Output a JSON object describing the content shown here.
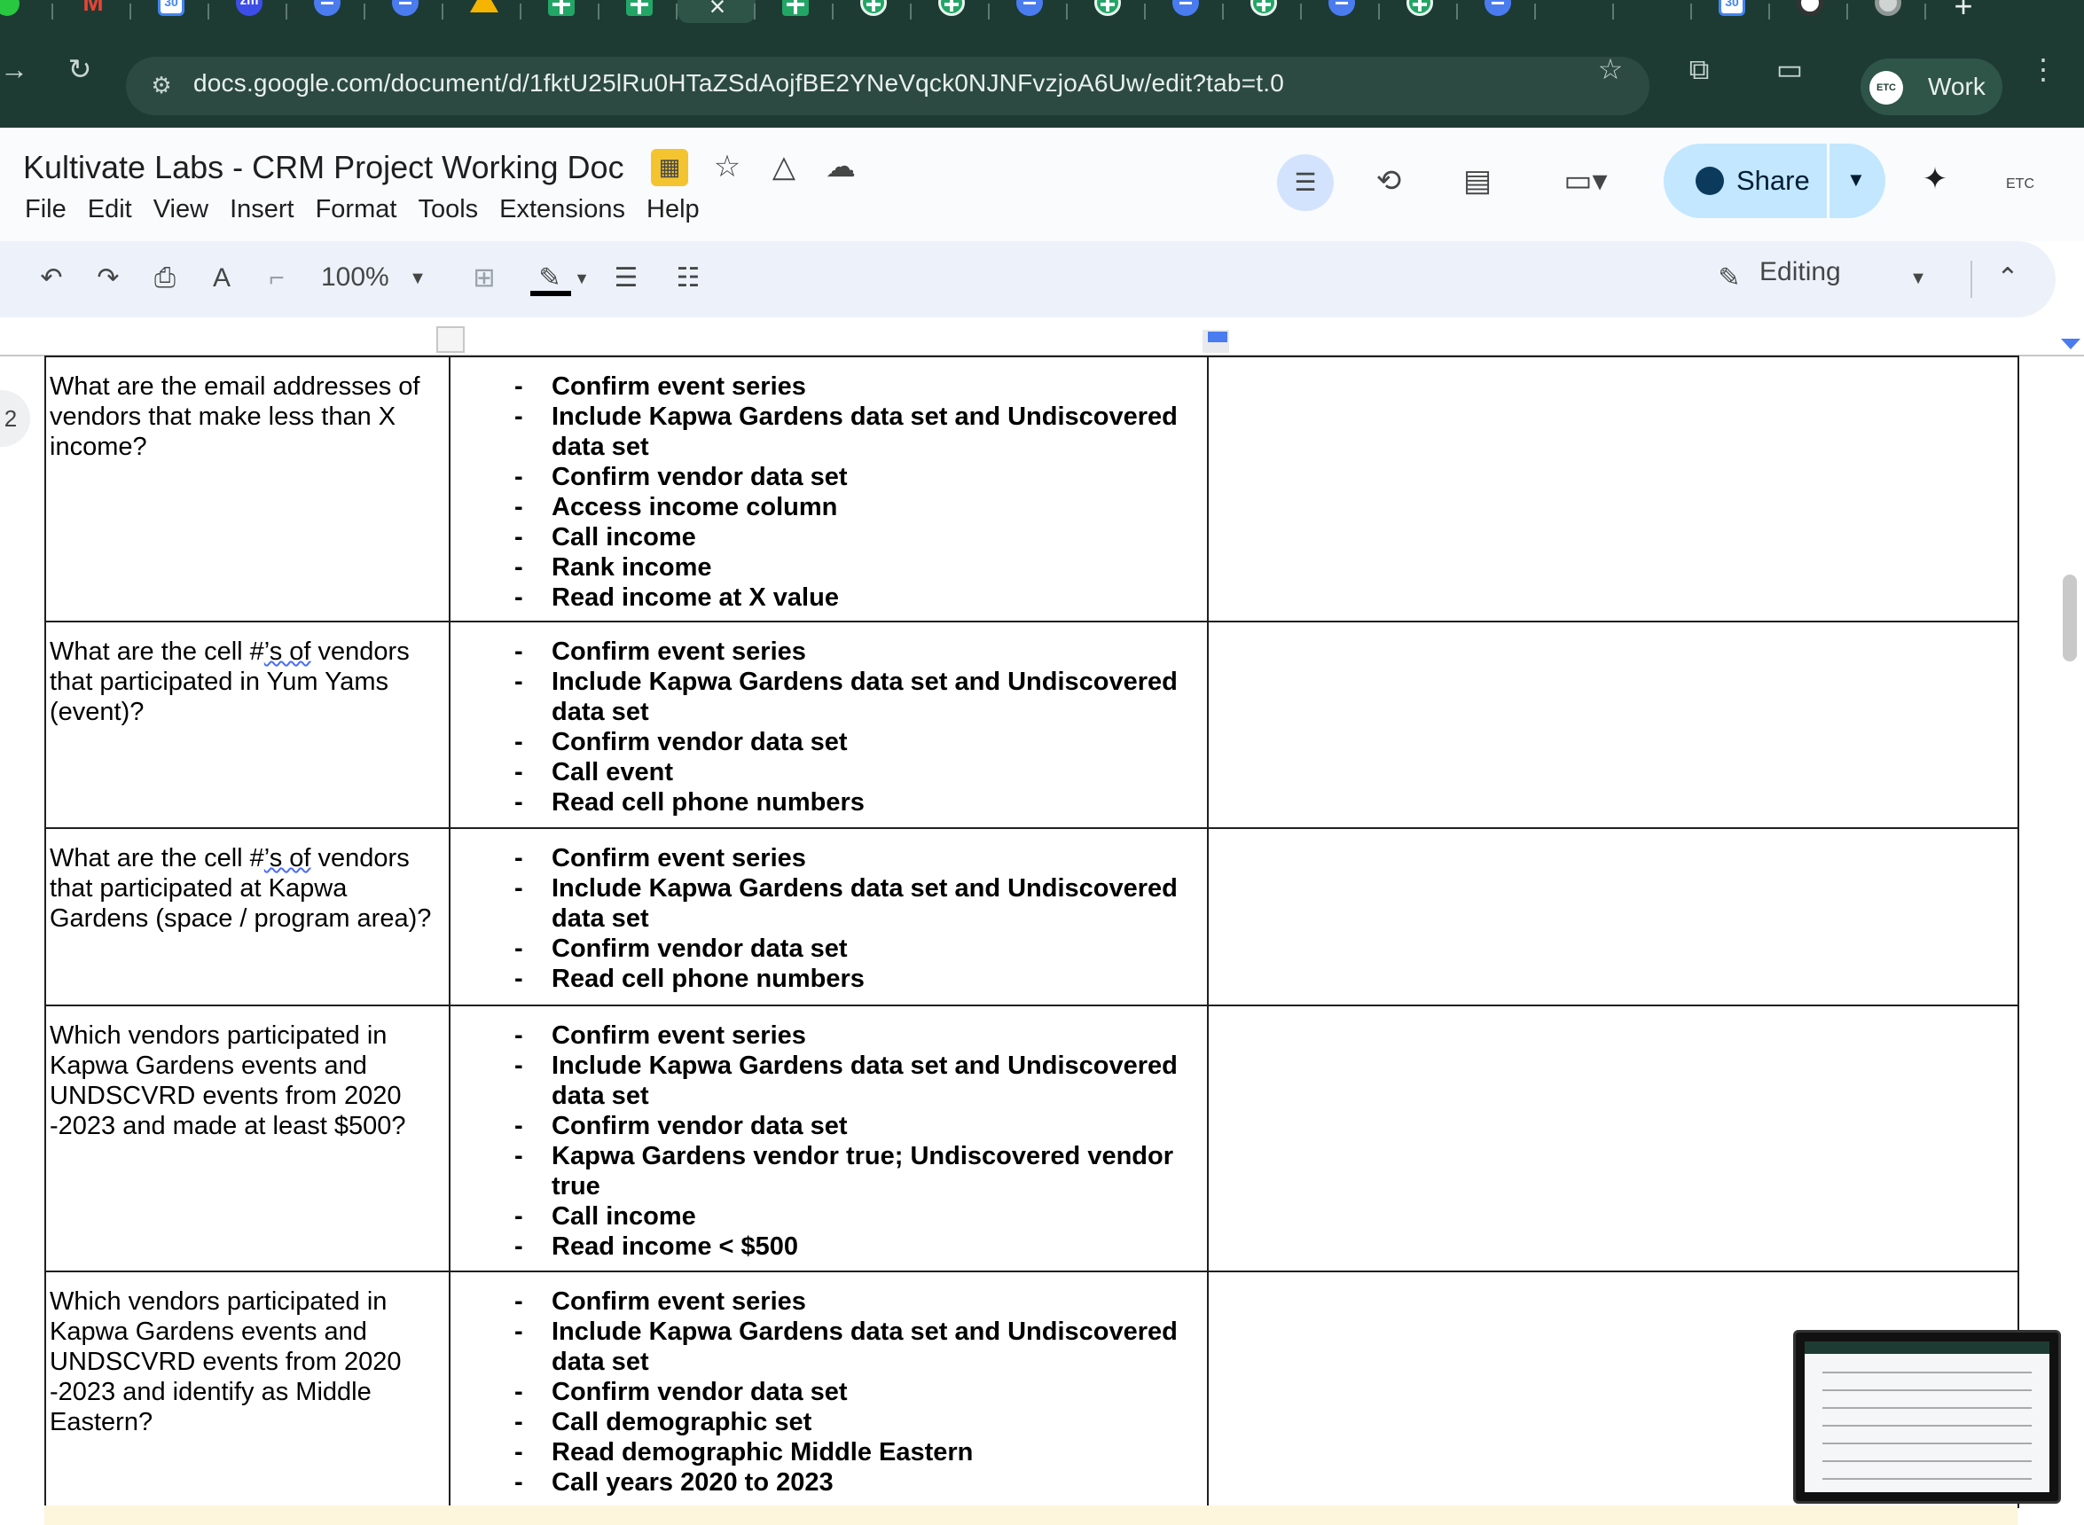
{
  "browser": {
    "tabs": [
      {
        "icon": "green-circle-icon"
      },
      {
        "icon": "gmail-icon",
        "glyph": "M"
      },
      {
        "icon": "calendar-icon",
        "glyph": "30"
      },
      {
        "icon": "zoom-icon",
        "glyph": "zm"
      },
      {
        "icon": "docs-icon"
      },
      {
        "icon": "docs-icon"
      },
      {
        "icon": "drive-icon"
      },
      {
        "icon": "sheets-icon"
      },
      {
        "icon": "sheets-icon"
      },
      {
        "icon": "close-icon",
        "glyph": "×"
      },
      {
        "icon": "sheets-icon"
      },
      {
        "icon": "sheets-icon"
      },
      {
        "icon": "sheets-icon"
      },
      {
        "icon": "docs-icon"
      },
      {
        "icon": "sheets-icon"
      },
      {
        "icon": "docs-icon"
      },
      {
        "icon": "sheets-icon"
      },
      {
        "icon": "docs-icon"
      },
      {
        "icon": "sheets-icon"
      },
      {
        "icon": "docs-icon"
      },
      {
        "icon": "extension-icon"
      },
      {
        "icon": "gemini-icon"
      },
      {
        "icon": "calendar-icon",
        "glyph": "30"
      },
      {
        "icon": "record-icon"
      },
      {
        "icon": "chrome-icon"
      }
    ],
    "new_tab_glyph": "+",
    "url": "docs.google.com/document/d/1fktU25lRu0HTaZSdAojfBE2YNeVqck0NJNFvzjoA6Uw/edit?tab=t.0",
    "profile": {
      "avatar_text": "ETC",
      "label": "Work"
    }
  },
  "doc": {
    "title": "Kultivate Labs - CRM Project Working Doc",
    "menu": [
      "File",
      "Edit",
      "View",
      "Insert",
      "Format",
      "Tools",
      "Extensions",
      "Help"
    ],
    "share_label": "Share",
    "account_text": "ETC",
    "zoom": "100%",
    "mode": "Editing",
    "page_number": "2"
  },
  "table": {
    "rows": [
      {
        "question": "What are the email addresses of vendors that make less than X income?",
        "steps": [
          "Confirm event series",
          "Include Kapwa Gardens data set and Undiscovered data set",
          "Confirm vendor data set",
          "Access income column",
          "Call income",
          "Rank income",
          "Read income at X value"
        ],
        "notes": ""
      },
      {
        "question_parts": [
          "What are the cell #",
          "’s of",
          " vendors that participated in Yum Yams (event)?"
        ],
        "steps": [
          "Confirm event series",
          "Include Kapwa Gardens data set and Undiscovered data set",
          "Confirm vendor data set",
          "Call event",
          "Read cell phone numbers"
        ],
        "notes": ""
      },
      {
        "question_parts": [
          "What are the cell #",
          "’s of",
          " vendors that participated at Kapwa Gardens (space / program area)?"
        ],
        "steps": [
          "Confirm event series",
          "Include Kapwa Gardens data set and Undiscovered data set",
          "Confirm vendor data set",
          "Read cell phone numbers"
        ],
        "notes": ""
      },
      {
        "question": "Which vendors participated in Kapwa Gardens events and UNDSCVRD events from 2020 -2023 and made at least $500?",
        "steps": [
          "Confirm event series",
          "Include Kapwa Gardens data set and Undiscovered data set",
          "Confirm vendor data set",
          "Kapwa Gardens vendor true; Undiscovered vendor true",
          "Call income",
          "Read income < $500"
        ],
        "notes": ""
      },
      {
        "question": "Which vendors participated in Kapwa Gardens events and UNDSCVRD events from 2020 -2023 and identify as Middle Eastern?",
        "steps": [
          "Confirm event series",
          "Include Kapwa Gardens data set and Undiscovered data set",
          "Confirm vendor data set",
          "Call demographic set",
          "Read demographic Middle Eastern",
          "Call years 2020 to 2023"
        ],
        "notes": ""
      }
    ]
  },
  "colors": {
    "chrome_frame": "#1e3b33",
    "share_button": "#c2e7ff",
    "toolbar_bg": "#edf2fa"
  }
}
